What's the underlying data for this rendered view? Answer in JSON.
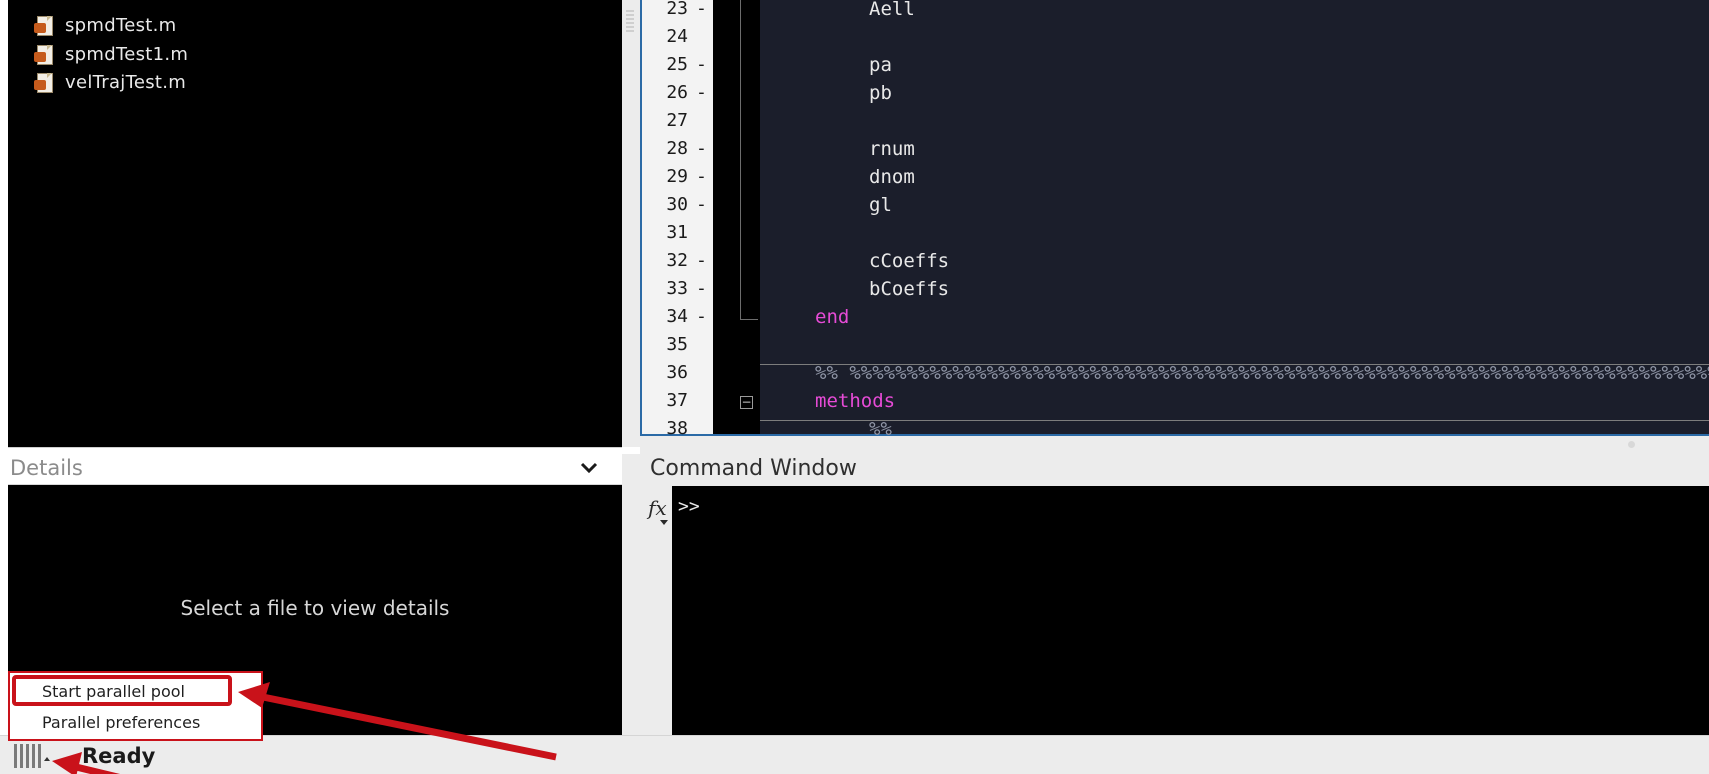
{
  "file_browser": {
    "files": [
      {
        "name": "spmdTest.m",
        "icon": "matlab-file-icon"
      },
      {
        "name": "spmdTest1.m",
        "icon": "matlab-file-icon"
      },
      {
        "name": "velTrajTest.m",
        "icon": "matlab-file-icon"
      }
    ]
  },
  "editor": {
    "lines": [
      {
        "num": "23",
        "dash": "-",
        "text": "Aell"
      },
      {
        "num": "24",
        "dash": "",
        "text": ""
      },
      {
        "num": "25",
        "dash": "-",
        "text": "pa"
      },
      {
        "num": "26",
        "dash": "-",
        "text": "pb"
      },
      {
        "num": "27",
        "dash": "",
        "text": ""
      },
      {
        "num": "28",
        "dash": "-",
        "text": "rnum"
      },
      {
        "num": "29",
        "dash": "-",
        "text": "dnom"
      },
      {
        "num": "30",
        "dash": "-",
        "text": "gl"
      },
      {
        "num": "31",
        "dash": "",
        "text": ""
      },
      {
        "num": "32",
        "dash": "-",
        "text": "cCoeffs"
      },
      {
        "num": "33",
        "dash": "-",
        "text": "bCoeffs"
      },
      {
        "num": "34",
        "dash": "-",
        "text": "end"
      },
      {
        "num": "35",
        "dash": "",
        "text": ""
      },
      {
        "num": "36",
        "dash": "",
        "text": "%% %%%%%%%%%%%%%%%%%%%%%%%%%%%%%%%%%%%%%%%%%%%%%%%%%%%%%%%%%%%%%%%%%%%%%%%%%%%%"
      },
      {
        "num": "37",
        "dash": "",
        "text": "methods"
      },
      {
        "num": "38",
        "dash": "",
        "text": "%%"
      }
    ]
  },
  "details": {
    "title": "Details",
    "empty_message": "Select a file to view details"
  },
  "command_window": {
    "title": "Command Window",
    "fx_label": "fx",
    "prompt": ">>"
  },
  "status_bar": {
    "status": "Ready"
  },
  "popup_menu": {
    "items": [
      "Start parallel pool",
      "Parallel preferences"
    ]
  },
  "colors": {
    "annotation_red": "#c9121a",
    "keyword_magenta": "#e64bd6",
    "editor_background": "#1b1e2b"
  }
}
